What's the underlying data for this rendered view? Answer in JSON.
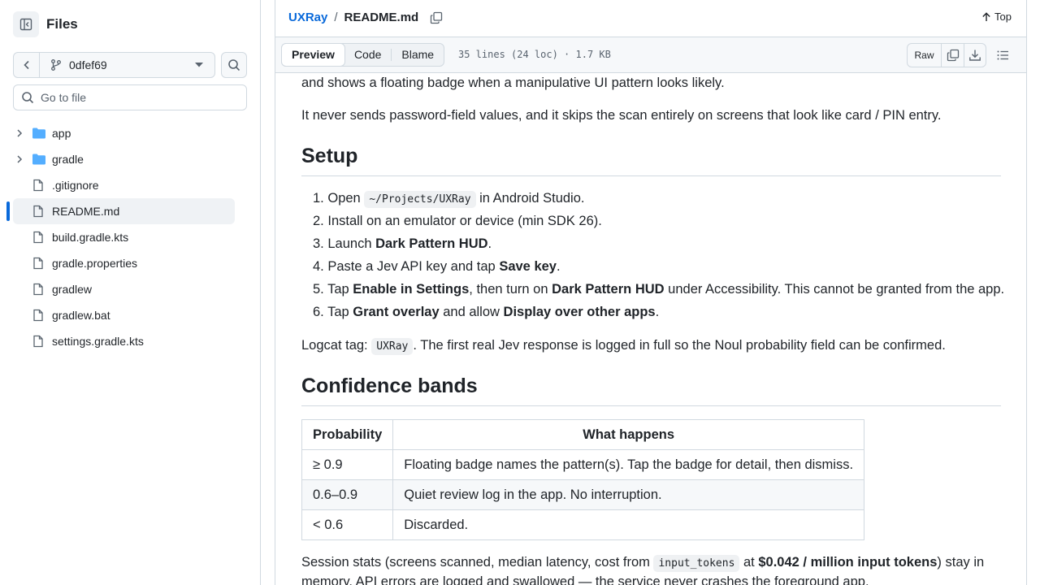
{
  "sidebar": {
    "title": "Files",
    "branch": "0dfef69",
    "goto_placeholder": "Go to file",
    "items": [
      {
        "label": "app",
        "type": "folder"
      },
      {
        "label": "gradle",
        "type": "folder"
      },
      {
        "label": ".gitignore",
        "type": "file"
      },
      {
        "label": "README.md",
        "type": "file",
        "selected": true
      },
      {
        "label": "build.gradle.kts",
        "type": "file"
      },
      {
        "label": "gradle.properties",
        "type": "file"
      },
      {
        "label": "gradlew",
        "type": "file"
      },
      {
        "label": "gradlew.bat",
        "type": "file"
      },
      {
        "label": "settings.gradle.kts",
        "type": "file"
      }
    ]
  },
  "header": {
    "repo": "UXRay",
    "separator": "/",
    "file": "README.md",
    "top_label": "Top"
  },
  "file_bar": {
    "tabs": [
      "Preview",
      "Code",
      "Blame"
    ],
    "active_tab": "Preview",
    "meta": "35 lines (24 loc) · 1.7 KB",
    "raw_label": "Raw"
  },
  "content": {
    "p0": "and shows a floating badge when a manipulative UI pattern looks likely.",
    "p1": "It never sends password-field values, and it skips the scan entirely on screens that look like card / PIN entry.",
    "setup_heading": "Setup",
    "steps": {
      "s1": {
        "num": "1.",
        "a": "Open ",
        "code": "~/Projects/UXRay",
        "b": " in Android Studio."
      },
      "s2": {
        "num": "2.",
        "text": "Install on an emulator or device (min SDK 26)."
      },
      "s3": {
        "num": "3.",
        "a": "Launch ",
        "bold": "Dark Pattern HUD",
        "b": "."
      },
      "s4": {
        "num": "4.",
        "a": "Paste a Jev API key and tap ",
        "bold": "Save key",
        "b": "."
      },
      "s5": {
        "num": "5.",
        "a": "Tap ",
        "bold1": "Enable in Settings",
        "b": ", then turn on ",
        "bold2": "Dark Pattern HUD",
        "c": " under Accessibility. This cannot be granted from the app."
      },
      "s6": {
        "num": "6.",
        "a": "Tap ",
        "bold1": "Grant overlay",
        "b": " and allow ",
        "bold2": "Display over other apps",
        "c": "."
      }
    },
    "logcat": {
      "a": "Logcat tag: ",
      "code": "UXRay",
      "b": ". The first real Jev response is logged in full so the Noul probability field can be confirmed."
    },
    "bands_heading": "Confidence bands",
    "table": {
      "headers": [
        "Probability",
        "What happens"
      ],
      "rows": [
        [
          "≥ 0.9",
          "Floating badge names the pattern(s). Tap the badge for detail, then dismiss."
        ],
        [
          "0.6–0.9",
          "Quiet review log in the app. No interruption."
        ],
        [
          "< 0.6",
          "Discarded."
        ]
      ]
    },
    "session": {
      "a": "Session stats (screens scanned, median latency, cost from ",
      "code": "input_tokens",
      "b": " at ",
      "bold": "$0.042 / million input tokens",
      "c": ") stay in"
    },
    "session2": "memory. API errors are logged and swallowed — the service never crashes the foreground app."
  },
  "colors": {
    "link": "#0969da",
    "folder": "#54aeff",
    "border": "#d1d9e0"
  }
}
